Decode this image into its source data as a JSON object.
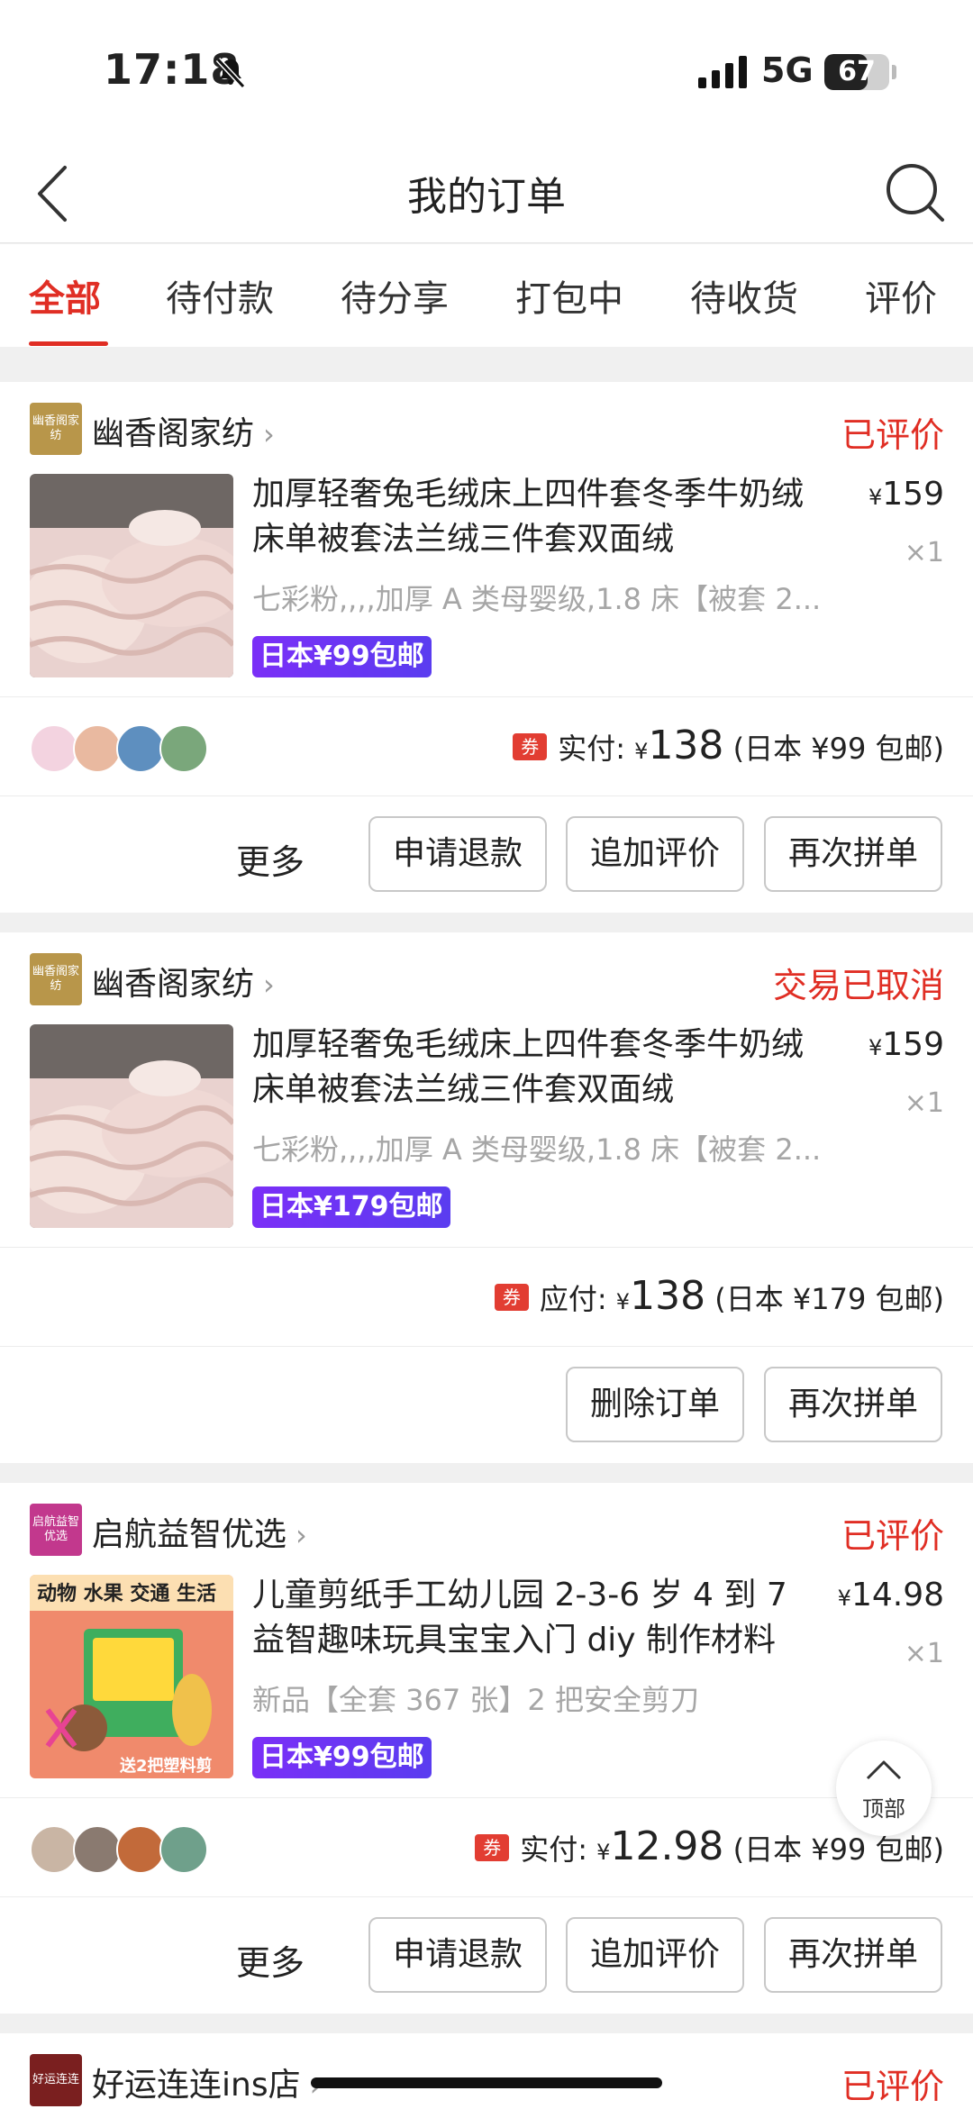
{
  "status_bar": {
    "time": "17:18",
    "network": "5G",
    "battery": "67",
    "battery_level": 0.67
  },
  "nav": {
    "title": "我的订单"
  },
  "tabs": [
    {
      "label": "全部",
      "active": true
    },
    {
      "label": "待付款"
    },
    {
      "label": "待分享"
    },
    {
      "label": "打包中"
    },
    {
      "label": "待收货"
    },
    {
      "label": "评价"
    }
  ],
  "orders": [
    {
      "shop_logo": "幽香阁家纺",
      "shop_name": "幽香阁家纺",
      "status": "已评价",
      "title": "加厚轻奢兔毛绒床上四件套冬季牛奶绒床单被套法兰绒三件套双面绒",
      "spec": "七彩粉,,,,加厚 A 类母婴级,1.8 床【被套 2...",
      "promo": "日本¥99包邮",
      "price_symbol": "¥",
      "price": "159",
      "qty": "×1",
      "pay_label": "实付:",
      "pay_symbol": "¥",
      "pay_amount": "138",
      "pay_note": "(日本 ¥99 包邮)",
      "coupon": "券",
      "more": "更多",
      "buttons": [
        "申请退款",
        "追加评价",
        "再次拼单"
      ]
    },
    {
      "shop_logo": "幽香阁家纺",
      "shop_name": "幽香阁家纺",
      "status": "交易已取消",
      "title": "加厚轻奢兔毛绒床上四件套冬季牛奶绒床单被套法兰绒三件套双面绒",
      "spec": "七彩粉,,,,加厚 A 类母婴级,1.8 床【被套 2...",
      "promo": "日本¥179包邮",
      "price_symbol": "¥",
      "price": "159",
      "qty": "×1",
      "pay_label": "应付:",
      "pay_symbol": "¥",
      "pay_amount": "138",
      "pay_note": "(日本 ¥179 包邮)",
      "coupon": "券",
      "buttons": [
        "删除订单",
        "再次拼单"
      ]
    },
    {
      "shop_logo": "启航益智优选",
      "shop_name": "启航益智优选",
      "status": "已评价",
      "title": "儿童剪纸手工幼儿园 2-3-6 岁 4 到 7 益智趣味玩具宝宝入门 diy 制作材料",
      "spec": "新品【全套 367 张】2 把安全剪刀",
      "promo": "日本¥99包邮",
      "image_text_top": "动物 水果 交通 生活",
      "image_text_bottom": "送2把塑料剪",
      "price_symbol": "¥",
      "price": "14.98",
      "qty": "×1",
      "pay_label": "实付:",
      "pay_symbol": "¥",
      "pay_amount": "12.98",
      "pay_note": "(日本 ¥99 包邮)",
      "coupon": "券",
      "more": "更多",
      "buttons": [
        "申请退款",
        "追加评价",
        "再次拼单"
      ]
    },
    {
      "shop_logo": "好运连连",
      "shop_name": "好运连连ins店",
      "status": "已评价"
    }
  ],
  "fab": {
    "label": "顶部"
  },
  "colors": {
    "accent": "#e02e24",
    "promo": "#6a35f3",
    "muted": "#a6a6a6"
  }
}
